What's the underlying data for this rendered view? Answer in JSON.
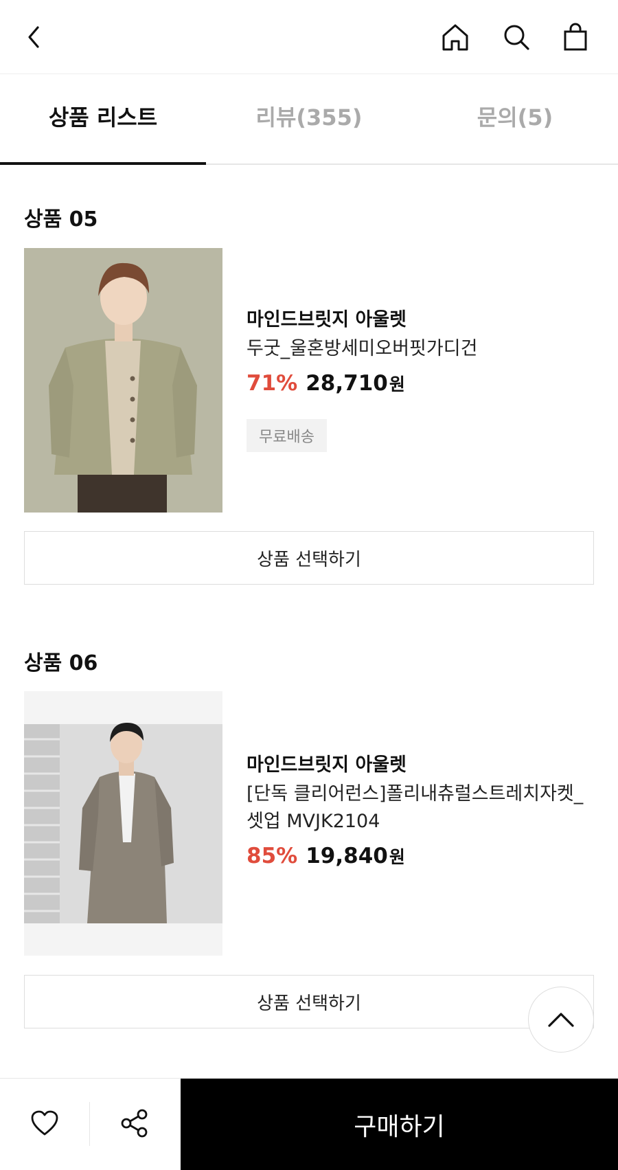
{
  "header": {
    "icons": [
      "back-icon",
      "home-icon",
      "search-icon",
      "shopping-bag-icon"
    ]
  },
  "tabs": [
    {
      "label": "상품 리스트",
      "active": true
    },
    {
      "label": "리뷰(355)",
      "active": false
    },
    {
      "label": "문의(5)",
      "active": false
    }
  ],
  "products": [
    {
      "section_title": "상품 05",
      "brand": "마인드브릿지 아울렛",
      "name": "두굿_울혼방세미오버핏가디건",
      "name_line2": "",
      "discount": "71%",
      "price": "28,710",
      "currency": "원",
      "badge": "무료배송",
      "select_label": "상품 선택하기"
    },
    {
      "section_title": "상품 06",
      "brand": "마인드브릿지 아울렛",
      "name": "[단독 클리어런스]폴리내츄럴스트레치자켓_",
      "name_line2": "셋업 MVJK2104",
      "discount": "85%",
      "price": "19,840",
      "currency": "원",
      "badge": "",
      "select_label": "상품 선택하기"
    }
  ],
  "bottom_bar": {
    "buy_label": "구매하기",
    "icons": [
      "heart-icon",
      "share-icon"
    ]
  },
  "colors": {
    "discount": "#e04c3c",
    "buy_button_bg": "#000000",
    "active_tab": "#111111",
    "inactive_tab": "#aaaaaa"
  }
}
